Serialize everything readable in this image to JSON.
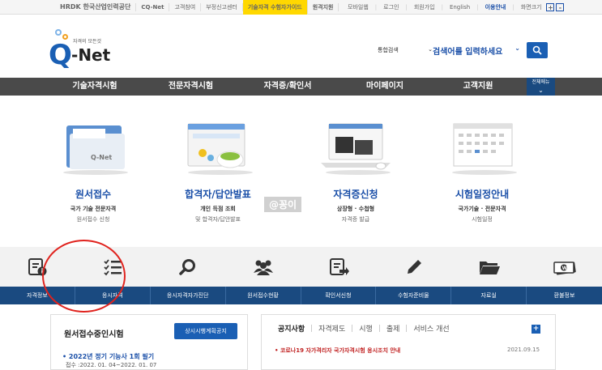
{
  "topbar": {
    "left": [
      "HRDK 한국산업인력공단",
      "CQ-Net",
      "고객참여",
      "부정신고센터",
      "기술자격 수험자가이드",
      "원격지원"
    ],
    "right": [
      "모바일웹",
      "로그인",
      "회원가입",
      "English",
      "이용안내",
      "화면크기"
    ],
    "zoom_in": "+",
    "zoom_out": "-"
  },
  "logo": {
    "tag": "자격의 모든것",
    "name": "Net",
    "q": "Q"
  },
  "search": {
    "category": "통합검색",
    "placeholder": "검색어를 입력하세요"
  },
  "gnb": {
    "items": [
      "기술자격시험",
      "전문자격시험",
      "자격증/확인서",
      "마이페이지",
      "고객지원"
    ],
    "all_menu": "전체메뉴"
  },
  "features": [
    {
      "title": "원서접수",
      "sub1": "국가 기술 전문자격",
      "sub2": "원서접수 신청"
    },
    {
      "title": "합격자/답안발표",
      "sub1": "개인 득점 조회",
      "sub2": "및 합격자/답안발표"
    },
    {
      "title": "자격증신청",
      "sub1": "상장형 · 수첩형",
      "sub2": "자격증 발급"
    },
    {
      "title": "시험일정안내",
      "sub1": "국가기술 · 전문자격",
      "sub2": "시험일정"
    }
  ],
  "watermark": "@꽁이",
  "quickmenu": [
    "자격정보",
    "응시자격",
    "응시자격자가진단",
    "원서접수현황",
    "확인서신청",
    "수험자준비물",
    "자료실",
    "환불정보"
  ],
  "panel_exam": {
    "title": "원서접수중인시험",
    "button": "상시시행계획공지",
    "item_title": "• 2022년 정기 기능사 1회 필기",
    "item_period": "접수 :2022. 01. 04~2022. 01. 07"
  },
  "panel_notice": {
    "tabs": [
      "공지사항",
      "자격제도",
      "시행",
      "출제",
      "서비스 개선"
    ],
    "plus": "+",
    "notice_title": "• 코로나19 자가격리자 국가자격시험 응시조치 안내",
    "notice_date": "2021.09.15"
  },
  "colors": {
    "brand_blue": "#1a5fb4",
    "nav_dark": "#4a4a4a",
    "label_navy": "#1a4a80",
    "guide_yellow": "#ffd800",
    "highlight_red": "#e0231e"
  }
}
